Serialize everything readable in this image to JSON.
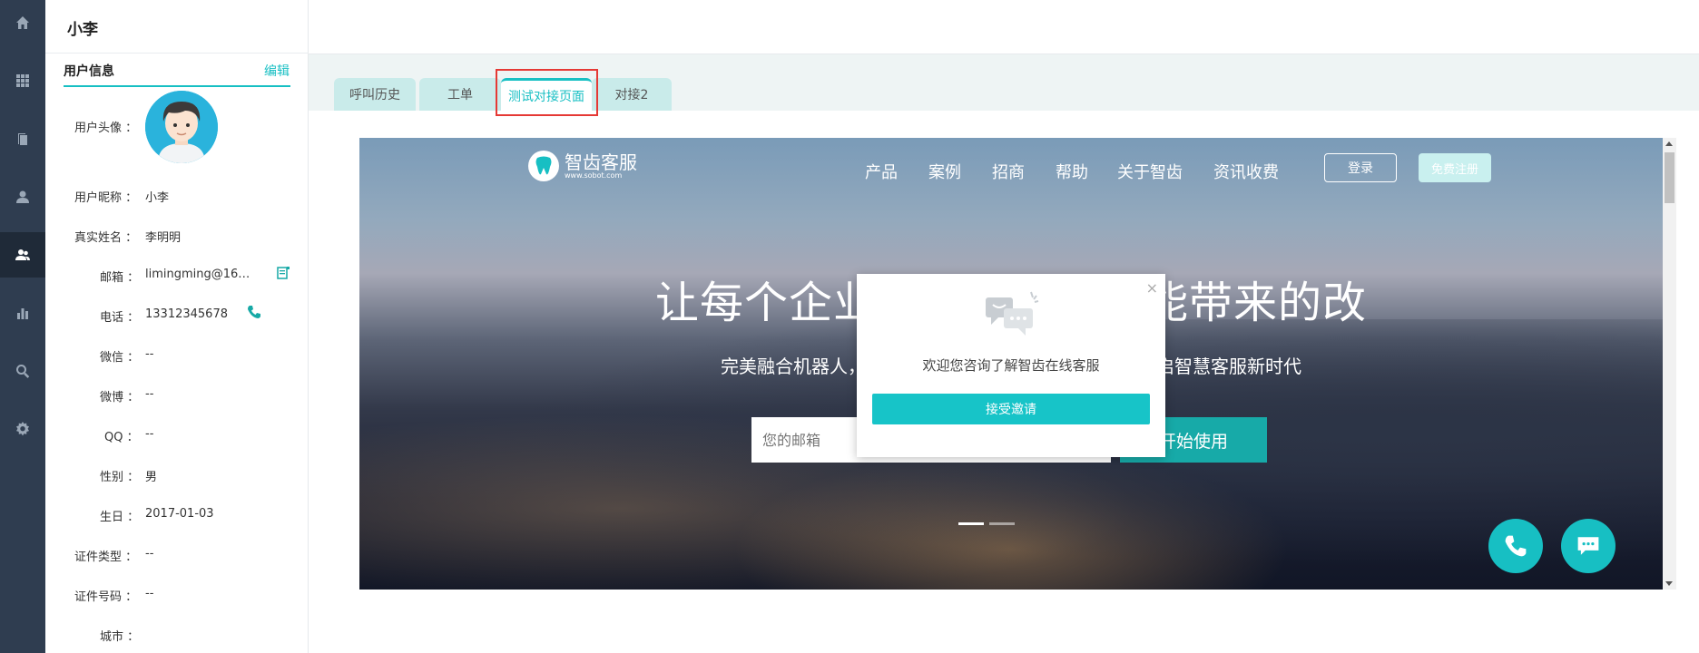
{
  "rail": {
    "items": [
      {
        "icon": "home-icon"
      },
      {
        "icon": "apps-grid-icon"
      },
      {
        "icon": "document-icon"
      },
      {
        "icon": "user-icon"
      },
      {
        "icon": "user-group-icon",
        "active": true
      },
      {
        "icon": "bar-chart-icon"
      },
      {
        "icon": "search-icon"
      },
      {
        "icon": "gear-icon"
      }
    ]
  },
  "user_panel": {
    "name": "小李",
    "section_title": "用户信息",
    "edit_label": "编辑",
    "fields": {
      "avatar_label": "用户头像 ：",
      "nickname_label": "用户昵称 ：",
      "nickname": "小李",
      "realname_label": "真实姓名 ：",
      "realname": "李明明",
      "email_label": "邮箱 ：",
      "email": "limingming@16…",
      "phone_label": "电话 ：",
      "phone": "13312345678",
      "wechat_label": "微信 ：",
      "wechat": "--",
      "weibo_label": "微博 ：",
      "weibo": "--",
      "qq_label": "QQ ：",
      "qq": "--",
      "gender_label": "性别 ：",
      "gender": "男",
      "birthday_label": "生日 ：",
      "birthday": "2017-01-03",
      "idtype_label": "证件类型 ：",
      "idtype": "--",
      "idnum_label": "证件号码 ：",
      "idnum": "--",
      "city_label": "城市 ："
    }
  },
  "tabs": [
    {
      "label": "呼叫历史"
    },
    {
      "label": "工单"
    },
    {
      "label": "测试对接页面",
      "active": true
    },
    {
      "label": "对接2"
    }
  ],
  "site": {
    "logo_text": "智齿客服",
    "logo_sub": "www.sobot.com",
    "nav": [
      "产品",
      "案例",
      "招商",
      "帮助",
      "关于智齿",
      "资讯收费"
    ],
    "login_label": "登录",
    "register_label": "免费注册",
    "hero_title": "让每个企业也都能享受智能带来的改变",
    "hero_sub": "完美融合机器人，人工客服，呼叫中心，工单系统，开启智慧客服新时代",
    "email_placeholder": "您的邮箱",
    "start_label": "开始使用"
  },
  "popup": {
    "message": "欢迎您咨询了解智齿在线客服",
    "accept_label": "接受邀请",
    "close_glyph": "×"
  },
  "colors": {
    "accent": "#17bfc3",
    "rail_bg": "#2f3d50",
    "highlight": "#e53935"
  }
}
